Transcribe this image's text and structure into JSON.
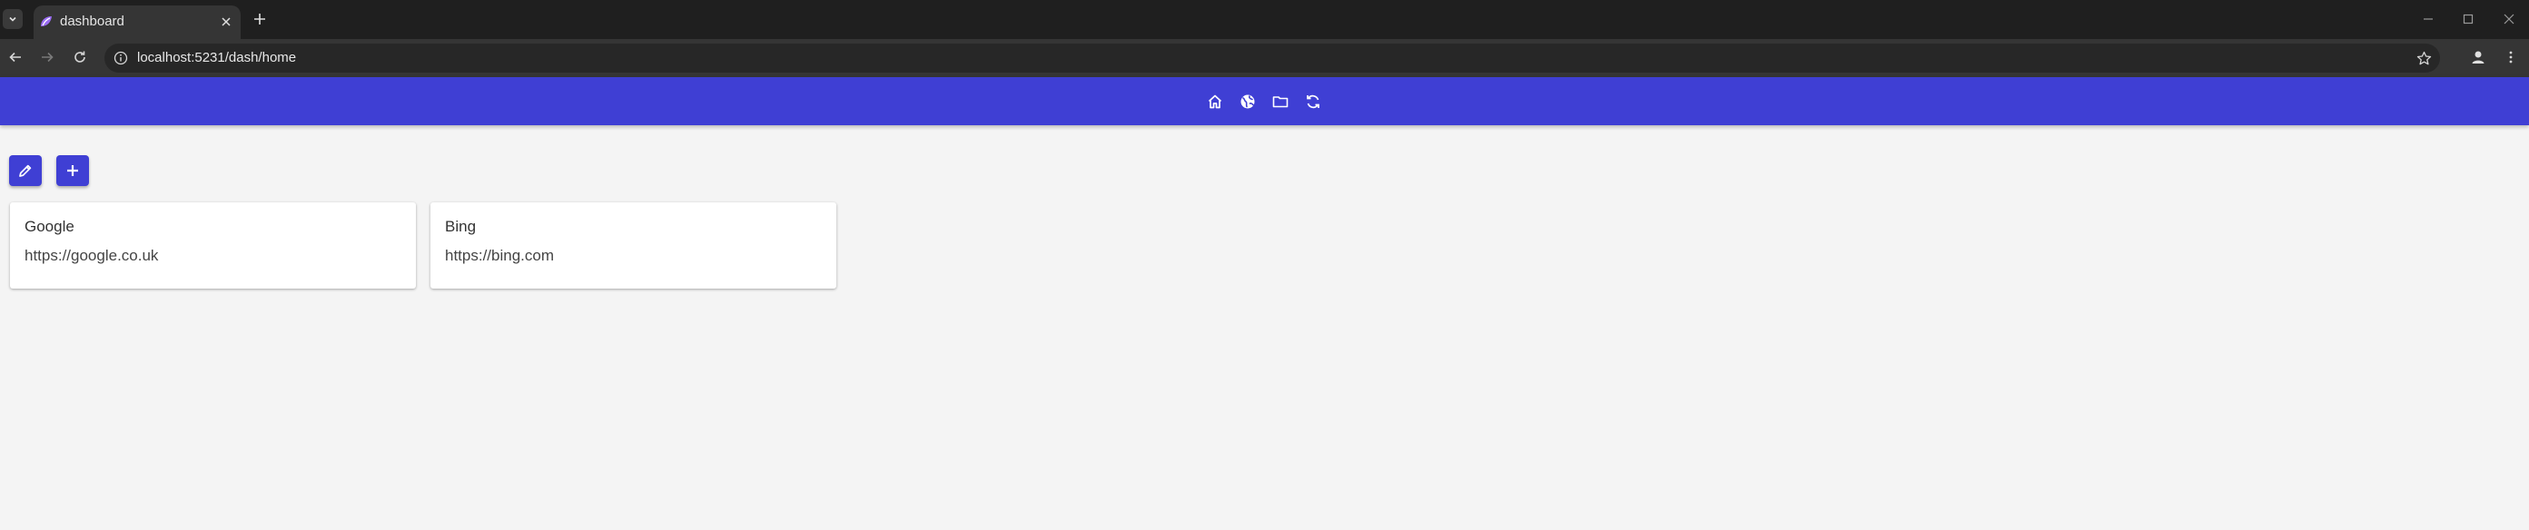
{
  "browser": {
    "tab_title": "dashboard",
    "url": "localhost:5231/dash/home"
  },
  "app": {
    "colors": {
      "primary": "#3f3fd4",
      "background": "#f4f4f4",
      "card": "#ffffff"
    },
    "nav_icons": [
      "home-icon",
      "globe-icon",
      "folder-icon",
      "refresh-icon"
    ],
    "actions": [
      "pencil-icon",
      "plus-icon"
    ],
    "cards": [
      {
        "title": "Google",
        "url": "https://google.co.uk"
      },
      {
        "title": "Bing",
        "url": "https://bing.com"
      }
    ]
  }
}
